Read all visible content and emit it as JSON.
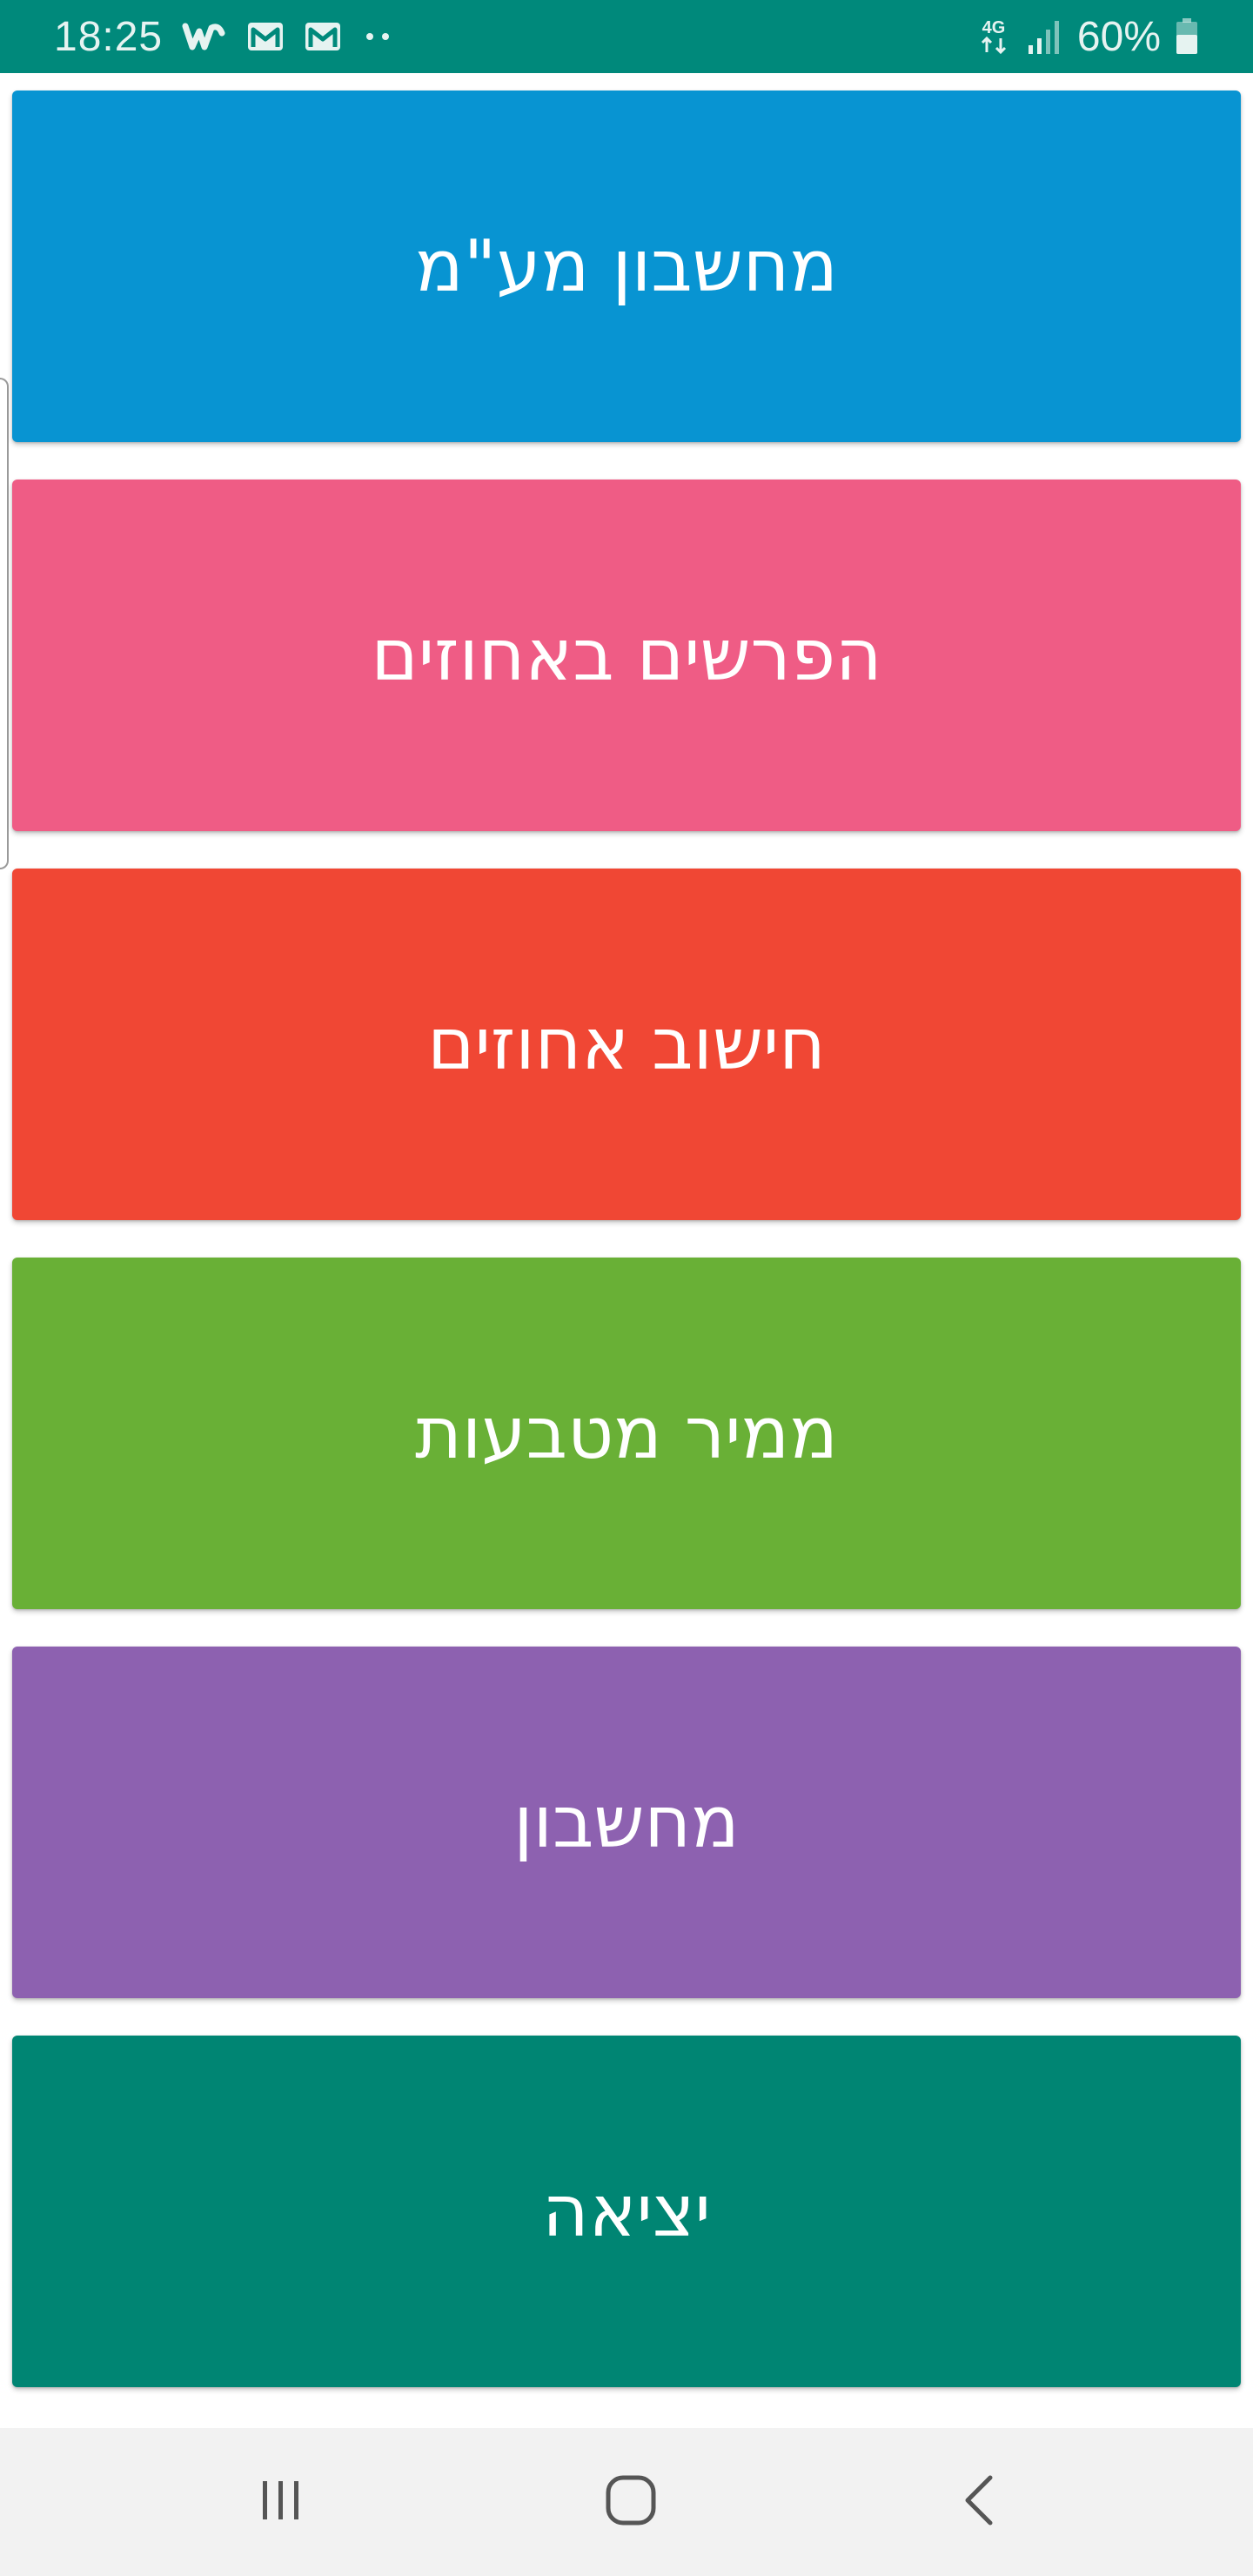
{
  "status_bar": {
    "time": "18:25",
    "network": "4G",
    "battery": "60%",
    "notification_icons": [
      "w-app-icon",
      "gmail-icon",
      "gmail-icon",
      "more-notifications-icon"
    ],
    "background_color": "#00897b"
  },
  "menu": {
    "buttons": [
      {
        "label": "מחשבון מע\"מ",
        "color": "#0894d2"
      },
      {
        "label": "הפרשים באחוזים",
        "color": "#ef5c85"
      },
      {
        "label": "חישוב אחוזים",
        "color": "#f04734"
      },
      {
        "label": "ממיר מטבעות",
        "color": "#69b036"
      },
      {
        "label": "מחשבון",
        "color": "#8d61b0"
      },
      {
        "label": "יציאה",
        "color": "#008573"
      }
    ]
  },
  "nav_bar": {
    "icons": [
      "recents-icon",
      "home-icon",
      "back-icon"
    ]
  }
}
